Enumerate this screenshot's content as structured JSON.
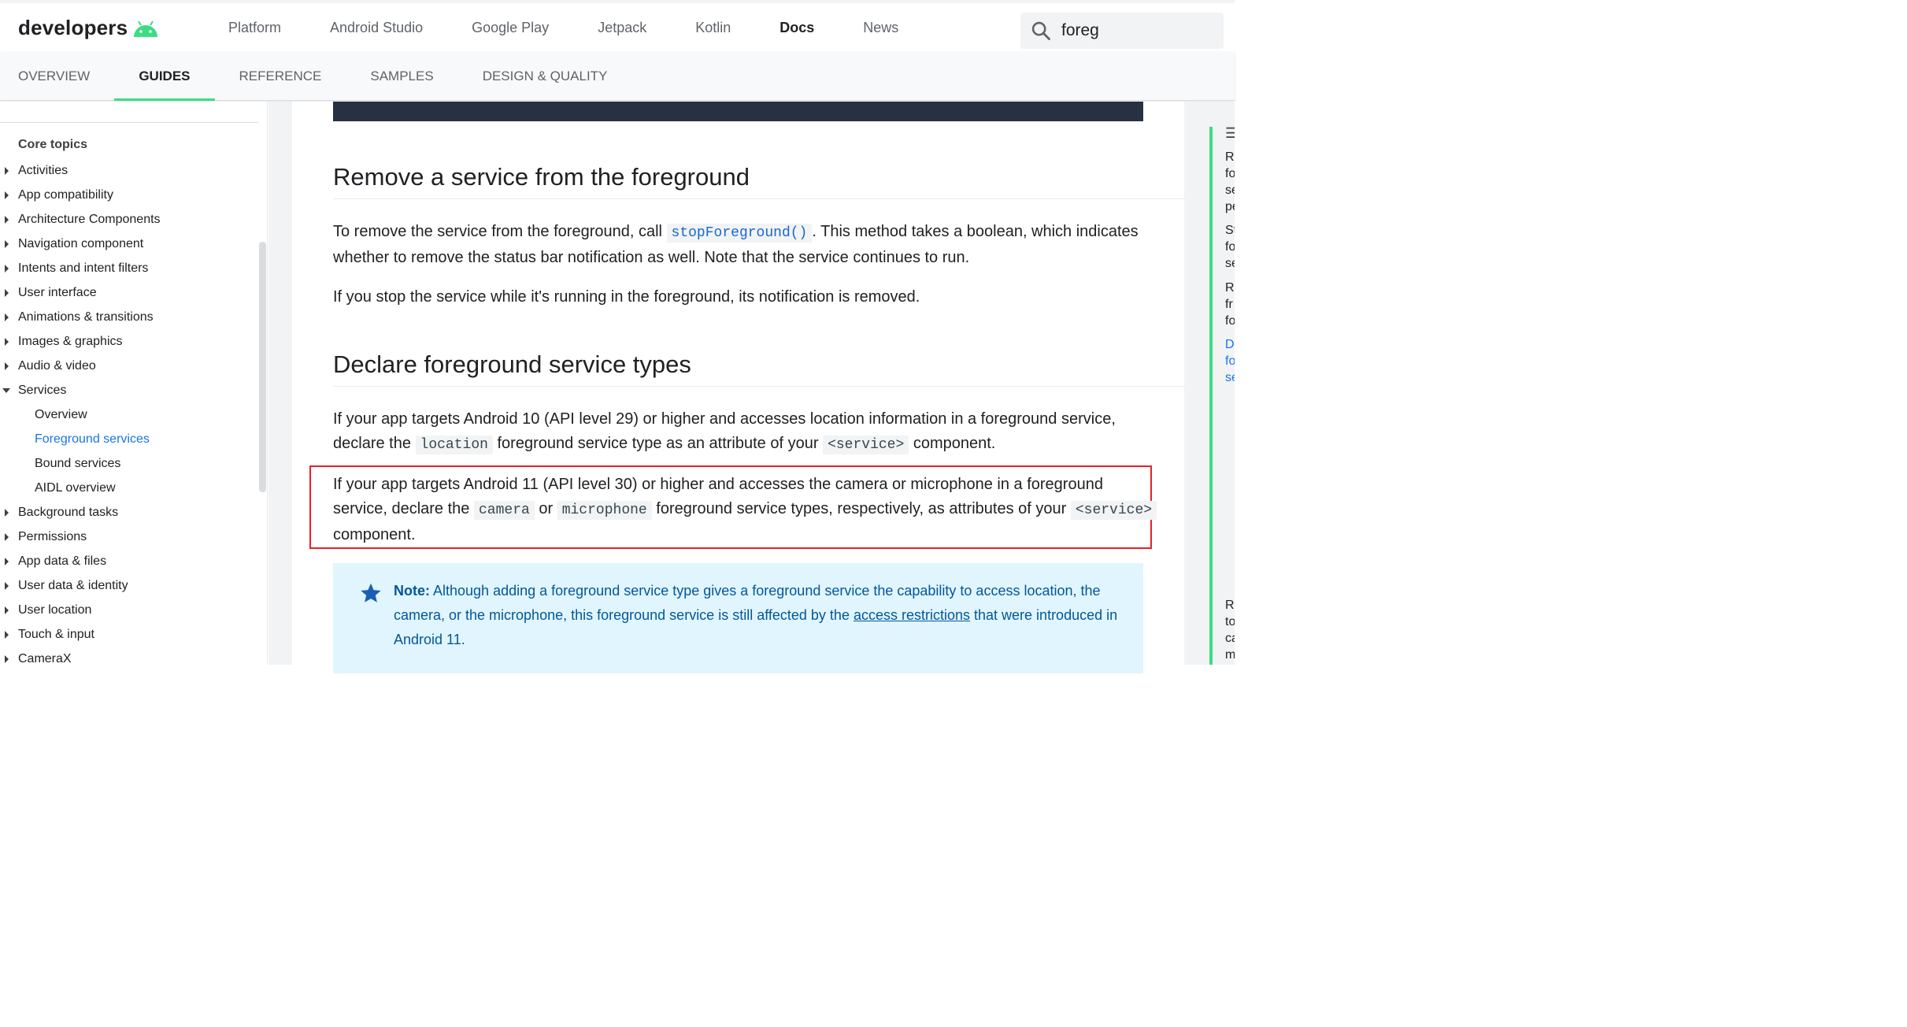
{
  "topbar": {
    "logo_text": "developers",
    "nav": [
      "Platform",
      "Android Studio",
      "Google Play",
      "Jetpack",
      "Kotlin",
      "Docs",
      "News"
    ],
    "active_nav": "Docs",
    "search_value": "foreg"
  },
  "subnav": {
    "tabs": [
      "OVERVIEW",
      "GUIDES",
      "REFERENCE",
      "SAMPLES",
      "DESIGN & QUALITY"
    ],
    "active": "GUIDES"
  },
  "sidebar": {
    "heading": "Core topics",
    "items": [
      {
        "label": "Activities"
      },
      {
        "label": "App compatibility"
      },
      {
        "label": "Architecture Components"
      },
      {
        "label": "Navigation component"
      },
      {
        "label": "Intents and intent filters"
      },
      {
        "label": "User interface"
      },
      {
        "label": "Animations & transitions"
      },
      {
        "label": "Images & graphics"
      },
      {
        "label": "Audio & video"
      },
      {
        "label": "Services"
      },
      {
        "label": "Overview"
      },
      {
        "label": "Foreground services"
      },
      {
        "label": "Bound services"
      },
      {
        "label": "AIDL overview"
      },
      {
        "label": "Background tasks"
      },
      {
        "label": "Permissions"
      },
      {
        "label": "App data & files"
      },
      {
        "label": "User data & identity"
      },
      {
        "label": "User location"
      },
      {
        "label": "Touch & input"
      },
      {
        "label": "CameraX"
      }
    ]
  },
  "article": {
    "section1": {
      "heading": "Remove a service from the foreground",
      "p1_before": "To remove the service from the foreground, call ",
      "p1_code": "stopForeground()",
      "p1_after": ". This method takes a boolean, which indicates whether to remove the status bar notification as well. Note that the service continues to run.",
      "p2": "If you stop the service while it's running in the foreground, its notification is removed."
    },
    "section2": {
      "heading": "Declare foreground service types",
      "p1_a": "If your app targets Android 10 (API level 29) or higher and accesses location information in a foreground service, declare the ",
      "p1_code1": "location",
      "p1_b": " foreground service type as an attribute of your ",
      "p1_code2": "<service>",
      "p1_c": " component.",
      "p2_a": "If your app targets Android 11 (API level 30) or higher and accesses the camera or microphone in a foreground service, declare the ",
      "p2_code1": "camera",
      "p2_b": " or ",
      "p2_code2": "microphone",
      "p2_c": " foreground service types, respectively, as attributes of your ",
      "p2_code3": "<service>",
      "p2_d": " component."
    },
    "note": {
      "label": "Note:",
      "text_a": " Although adding a foreground service type gives a foreground service the capability to access location, the camera, or the microphone, this foreground service is still affected by the ",
      "link": "access restrictions",
      "text_b": " that were introduced in Android 11."
    }
  },
  "toc": {
    "icon": "☰",
    "lines": [
      {
        "text": "R"
      },
      {
        "text": "fo"
      },
      {
        "text": "se"
      },
      {
        "text": "pe"
      },
      {
        "text": "St"
      },
      {
        "text": "fo"
      },
      {
        "text": "se"
      },
      {
        "text": "R"
      },
      {
        "text": "fr"
      },
      {
        "text": "fo"
      },
      {
        "text": "D"
      },
      {
        "text": "fo"
      },
      {
        "text": "se"
      },
      {
        "text": "R"
      },
      {
        "text": "to"
      },
      {
        "text": "ca"
      },
      {
        "text": "m"
      }
    ]
  },
  "colors": {
    "accent_green": "#3ddc84",
    "link_blue": "#1a73e8",
    "highlight_red": "#e8202a",
    "note_bg": "#e1f5fe"
  }
}
